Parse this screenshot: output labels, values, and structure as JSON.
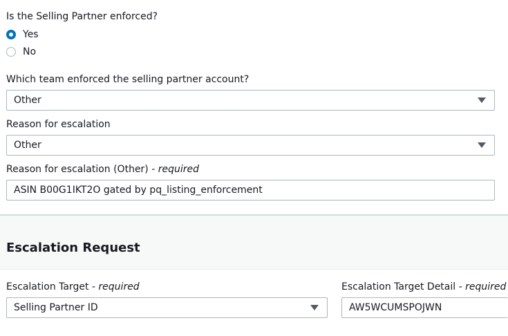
{
  "enforced_question": {
    "label": "Is the Selling Partner enforced?",
    "options": [
      {
        "label": "Yes",
        "checked": true
      },
      {
        "label": "No",
        "checked": false
      }
    ]
  },
  "enforcing_team": {
    "label": "Which team enforced the selling partner account?",
    "value": "Other"
  },
  "reason": {
    "label": "Reason for escalation",
    "value": "Other"
  },
  "reason_other": {
    "label": "Reason for escalation (Other)",
    "required_suffix": " - required",
    "value": "ASIN B00G1IKT2O gated by pq_listing_enforcement"
  },
  "escalation_request": {
    "title": "Escalation Request",
    "target": {
      "label": "Escalation Target",
      "required_suffix": " - required",
      "value": "Selling Partner ID"
    },
    "target_detail": {
      "label": "Escalation Target Detail",
      "required_suffix": " - required",
      "value": "AW5WCUMSPOJWN"
    }
  },
  "colors": {
    "accent": "#0073bb",
    "border": "#aab7b8",
    "text": "#16191f"
  }
}
